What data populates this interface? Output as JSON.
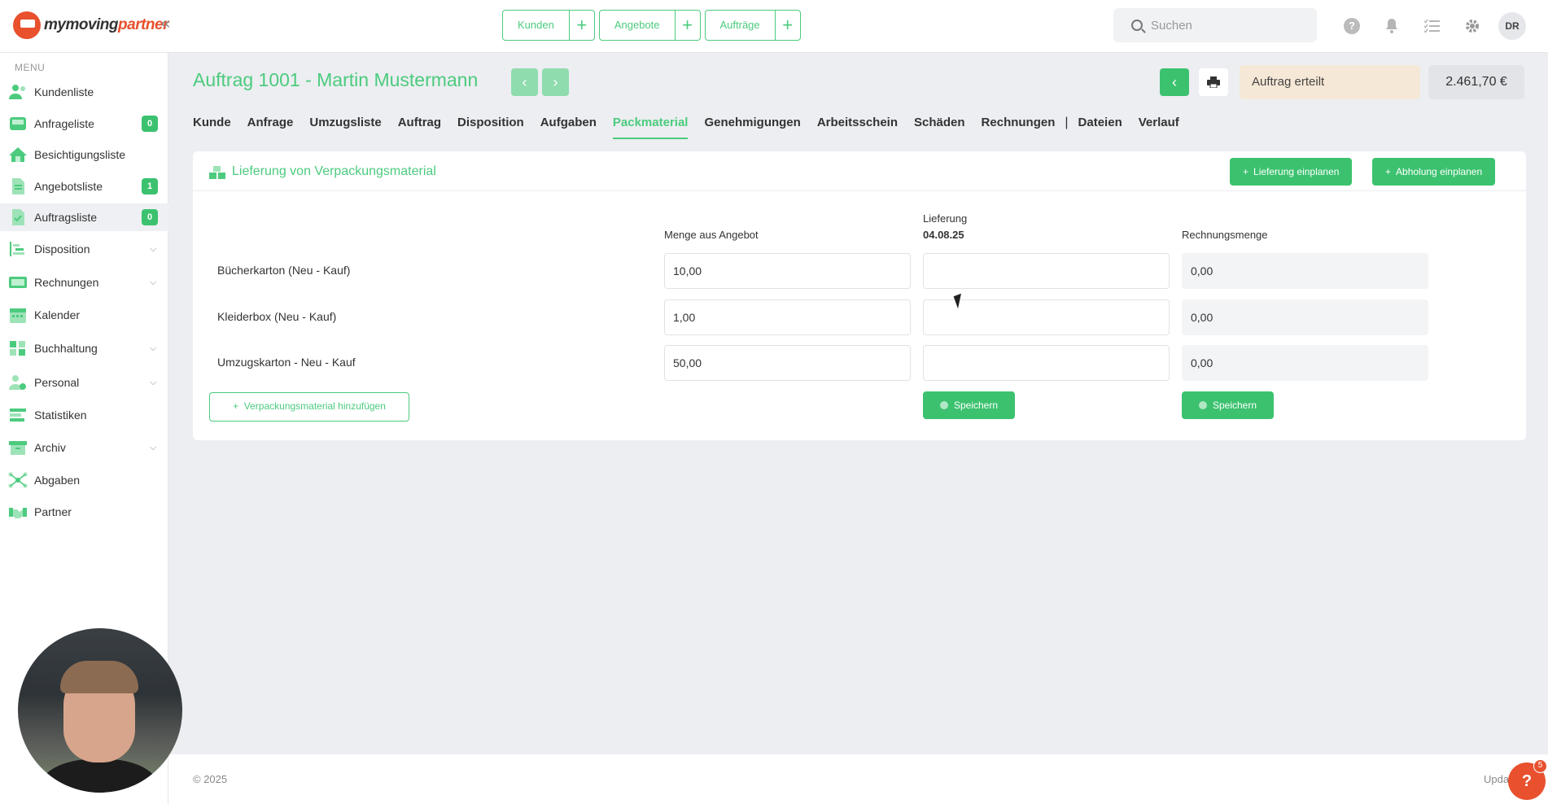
{
  "app": {
    "logo_text_1": "mymoving",
    "logo_text_2": "partner",
    "collapse_icon": "«"
  },
  "header": {
    "quick": [
      {
        "label": "Kunden",
        "plus": "+"
      },
      {
        "label": "Angebote",
        "plus": "+"
      },
      {
        "label": "Aufträge",
        "plus": "+"
      }
    ],
    "search_placeholder": "Suchen",
    "help_icon_text": "?",
    "avatar": "DR"
  },
  "sidebar": {
    "heading": "MENU",
    "items": [
      {
        "label": "Kundenliste",
        "badge": ""
      },
      {
        "label": "Anfrageliste",
        "badge": "0"
      },
      {
        "label": "Besichtigungsliste",
        "badge": ""
      },
      {
        "label": "Angebotsliste",
        "badge": "1"
      },
      {
        "label": "Auftragsliste",
        "badge": "0"
      },
      {
        "label": "Disposition",
        "chevron": "⌵"
      },
      {
        "label": "Rechnungen",
        "chevron": "⌵"
      },
      {
        "label": "Kalender"
      },
      {
        "label": "Buchhaltung",
        "chevron": "⌵"
      },
      {
        "label": "Personal",
        "chevron": "⌵"
      },
      {
        "label": "Statistiken"
      },
      {
        "label": "Archiv",
        "chevron": "⌵"
      },
      {
        "label": "Abgaben"
      },
      {
        "label": "Partner"
      }
    ]
  },
  "page": {
    "title": "Auftrag 1001 - Martin Mustermann",
    "prev": "‹",
    "next": "›",
    "back": "‹",
    "status": "Auftrag erteilt",
    "amount": "2.461,70 €"
  },
  "tabs": [
    "Kunde",
    "Anfrage",
    "Umzugsliste",
    "Auftrag",
    "Disposition",
    "Aufgaben",
    "Packmaterial",
    "Genehmigungen",
    "Arbeitsschein",
    "Schäden",
    "Rechnungen",
    "Dateien",
    "Verlauf"
  ],
  "tab_separator": "|",
  "panel": {
    "title": "Lieferung von Verpackungsmaterial",
    "btn_delivery": "Lieferung einplanen",
    "btn_pickup": "Abholung einplanen",
    "plus": "+",
    "col_offer": "Menge aus Angebot",
    "col_delivery": "Lieferung",
    "col_delivery_date": "04.08.25",
    "col_invoice": "Rechnungsmenge",
    "rows": [
      {
        "label": "Bücherkarton (Neu - Kauf)",
        "offer": "10,00",
        "delivery": "",
        "invoice": "0,00"
      },
      {
        "label": "Kleiderbox (Neu - Kauf)",
        "offer": "1,00",
        "delivery": "",
        "invoice": "0,00"
      },
      {
        "label": "Umzugskarton - Neu - Kauf",
        "offer": "50,00",
        "delivery": "",
        "invoice": "0,00"
      }
    ],
    "add_button": "Verpackungsmaterial hinzufügen",
    "save_label": "Speichern"
  },
  "footer": {
    "copyright": "© 2025",
    "update": "Upda"
  },
  "help": {
    "label": "?",
    "badge": "5"
  },
  "colors": {
    "accent": "#4ccb7e",
    "accent_dark": "#3cc26f",
    "brand": "#e8502e",
    "status_bg": "#f6e8d6"
  }
}
